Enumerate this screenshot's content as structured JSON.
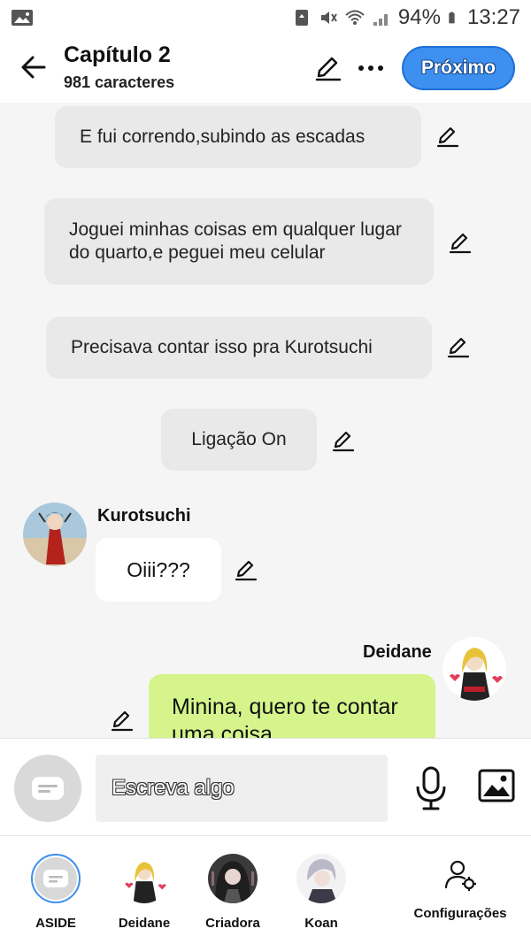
{
  "status_bar": {
    "battery": "94%",
    "time": "13:27"
  },
  "header": {
    "title": "Capítulo 2",
    "subtitle": "981 caracteres",
    "next_label": "Próximo"
  },
  "messages": {
    "narration_1": "E fui correndo,subindo as escadas",
    "narration_2": "Joguei minhas coisas em qualquer lugar do quarto,e peguei meu celular",
    "narration_3": "Precisava contar isso pra Kurotsuchi",
    "narration_4": "Ligação On",
    "msg1_sender": "Kurotsuchi",
    "msg1_text": "Oiii???",
    "msg2_sender": "Deidane",
    "msg2_text": "Minina, quero te contar uma coisa"
  },
  "composer": {
    "placeholder": "Escreva algo"
  },
  "bottom_bar": {
    "characters": [
      {
        "label": "ASIDE"
      },
      {
        "label": "Deidane"
      },
      {
        "label": "Criadora"
      },
      {
        "label": "Koan"
      }
    ],
    "settings_label": "Configurações"
  },
  "colors": {
    "accent": "#3d8ff0",
    "green_bubble": "#d5f58c",
    "narration": "#e9e9e9"
  }
}
